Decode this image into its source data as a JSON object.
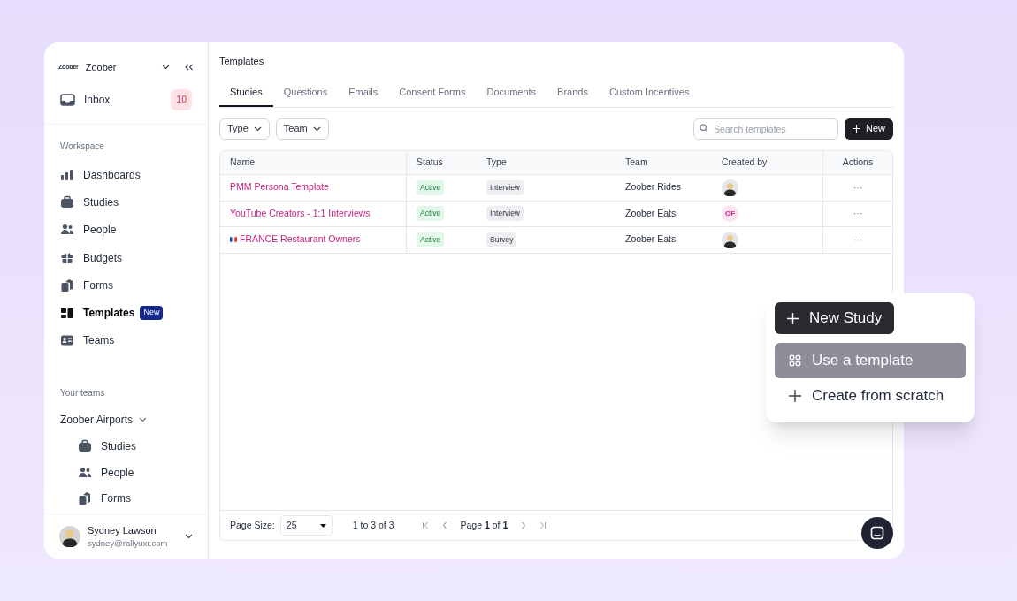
{
  "sidebar": {
    "org": {
      "logo": "Zoober",
      "name": "Zoober"
    },
    "inbox": {
      "label": "Inbox",
      "count": "10"
    },
    "workspace_heading": "Workspace",
    "items": [
      {
        "label": "Dashboards",
        "selected": false
      },
      {
        "label": "Studies",
        "selected": false
      },
      {
        "label": "People",
        "selected": false
      },
      {
        "label": "Budgets",
        "selected": false
      },
      {
        "label": "Forms",
        "selected": false
      },
      {
        "label": "Templates",
        "selected": true,
        "badge": "New"
      },
      {
        "label": "Teams",
        "selected": false
      }
    ],
    "teams_heading": "Your teams",
    "team": {
      "name": "Zoober Airports",
      "expanded": true,
      "children": [
        {
          "label": "Studies"
        },
        {
          "label": "People"
        },
        {
          "label": "Forms"
        }
      ]
    },
    "user": {
      "name": "Sydney Lawson",
      "email": "sydney@rallyuxr.com"
    }
  },
  "page_title": "Templates",
  "tabs": [
    {
      "label": "Studies",
      "selected": true
    },
    {
      "label": "Questions",
      "selected": false
    },
    {
      "label": "Emails",
      "selected": false
    },
    {
      "label": "Consent Forms",
      "selected": false
    },
    {
      "label": "Documents",
      "selected": false
    },
    {
      "label": "Brands",
      "selected": false
    },
    {
      "label": "Custom Incentives",
      "selected": false
    }
  ],
  "filters": [
    "Type",
    "Team"
  ],
  "search": {
    "placeholder": "Search templates"
  },
  "new_button": "New",
  "table": {
    "columns": [
      "Name",
      "Status",
      "Type",
      "Team",
      "Created by",
      "Actions"
    ],
    "rows": [
      {
        "name": "PMM Persona Template",
        "flag": false,
        "status": "Active",
        "type": "Interview",
        "team": "Zoober Rides",
        "creator": {
          "kind": "photo"
        },
        "actions": "···"
      },
      {
        "name": "YouTube Creators - 1:1 Interviews",
        "flag": false,
        "status": "Active",
        "type": "Interview",
        "team": "Zoober Eats",
        "creator": {
          "kind": "initials",
          "text": "OF"
        },
        "actions": "···"
      },
      {
        "name": "FRANCE Restaurant Owners",
        "flag": true,
        "status": "Active",
        "type": "Survey",
        "team": "Zoober Eats",
        "creator": {
          "kind": "photo"
        },
        "actions": "···"
      }
    ]
  },
  "pagination": {
    "page_size_label": "Page Size:",
    "page_size": "25",
    "range": "1 to 3 of 3",
    "page": "Page **1** of **1**"
  },
  "popup": {
    "button": "New Study",
    "items": [
      {
        "label": "Use a template",
        "selected": true,
        "kind": "template"
      },
      {
        "label": "Create from scratch",
        "selected": false,
        "kind": "plus"
      }
    ]
  }
}
